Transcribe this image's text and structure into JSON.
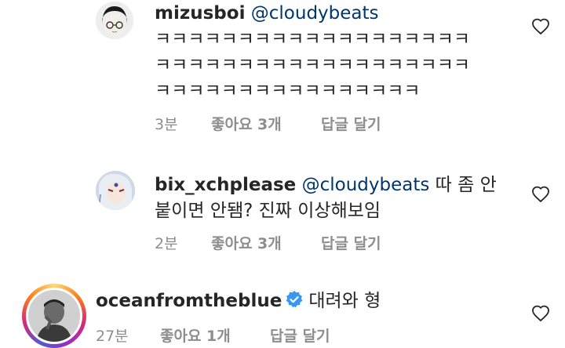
{
  "comments": [
    {
      "username": "mizusboi",
      "mention": "@cloudybeats",
      "text_lines": [
        "ㅋㅋㅋㅋㅋㅋㅋㅋㅋㅋㅋㅋㅋㅋㅋㅋㅋㅋㅋ",
        "ㅋㅋㅋㅋㅋㅋㅋㅋㅋㅋㅋㅋㅋㅋㅋㅋㅋㅋㅋ",
        "ㅋㅋㅋㅋㅋㅋㅋㅋㅋㅋㅋㅋㅋㅋㅋㅋ"
      ],
      "time": "3분",
      "likes": "좋아요 3개",
      "reply": "답글 달기"
    },
    {
      "username": "bix_xchplease",
      "mention": "@cloudybeats",
      "text_first": "따 좀 안",
      "text_second": "붙이면 안됌? 진짜 이상해보임",
      "time": "2분",
      "likes": "좋아요 3개",
      "reply": "답글 달기"
    },
    {
      "username": "oceanfromtheblue",
      "verified": true,
      "text": "대려와 형",
      "time": "27분",
      "likes": "좋아요 1개",
      "reply": "답글 달기"
    }
  ],
  "colors": {
    "text": "#262626",
    "mention": "#00376b",
    "meta": "#8e8e8e",
    "verified": "#3897f0"
  }
}
